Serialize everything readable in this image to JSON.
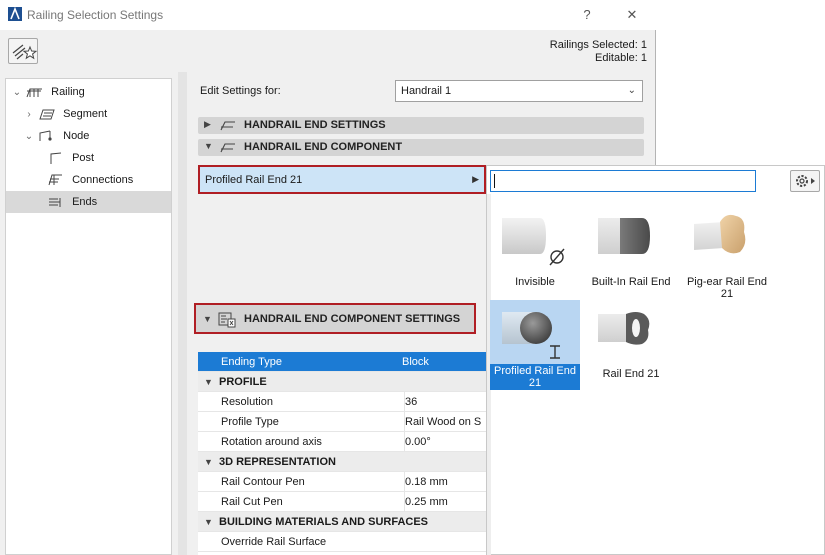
{
  "window": {
    "title": "Railing Selection Settings",
    "help_label": "?",
    "close_label": "✕"
  },
  "info": {
    "selected": "Railings Selected: 1",
    "editable": "Editable: 1"
  },
  "tree": {
    "items": [
      {
        "label": "Railing",
        "icon": "railing-icon",
        "expander": "expanded"
      },
      {
        "label": "Segment",
        "icon": "segment-icon",
        "expander": "collapsed"
      },
      {
        "label": "Node",
        "icon": "node-icon",
        "expander": "expanded"
      },
      {
        "label": "Post",
        "icon": "post-icon",
        "expander": "none"
      },
      {
        "label": "Connections",
        "icon": "connections-icon",
        "expander": "none"
      },
      {
        "label": "Ends",
        "icon": "ends-icon",
        "expander": "none",
        "selected": true
      }
    ]
  },
  "edit_settings": {
    "label": "Edit Settings for:",
    "value": "Handrail 1"
  },
  "sections": {
    "end_settings": "HANDRAIL END SETTINGS",
    "end_component": "HANDRAIL END COMPONENT",
    "component_settings": "HANDRAIL END COMPONENT SETTINGS"
  },
  "component": {
    "value": "Profiled Rail End 21"
  },
  "grid": {
    "ending_type": {
      "key": "Ending Type",
      "value": "Block"
    },
    "profile_header": "PROFILE",
    "profile_rows": [
      {
        "key": "Resolution",
        "value": "36"
      },
      {
        "key": "Profile Type",
        "value": "Rail Wood on S"
      },
      {
        "key": "Rotation around axis",
        "value": "0.00°"
      }
    ],
    "rep_header": "3D REPRESENTATION",
    "rep_rows": [
      {
        "key": "Rail Contour Pen",
        "value": "0.18 mm"
      },
      {
        "key": "Rail Cut Pen",
        "value": "0.25 mm"
      }
    ],
    "materials_header": "BUILDING MATERIALS AND SURFACES",
    "materials_rows": [
      {
        "key": "Override Rail Surface",
        "value": ""
      }
    ]
  },
  "popup": {
    "search_value": "",
    "tiles": [
      {
        "label": "Invisible",
        "icon": "invisible-rail-end-icon"
      },
      {
        "label": "Built-In Rail End",
        "icon": "built-in-rail-end-icon"
      },
      {
        "label": "Pig-ear Rail End 21",
        "icon": "pig-ear-rail-end-icon"
      },
      {
        "label": "Profiled Rail End 21",
        "icon": "profiled-rail-end-icon",
        "selected": true
      },
      {
        "label": "Rail End 21",
        "icon": "rail-end-icon"
      }
    ]
  },
  "colors": {
    "accent": "#1c7bd4",
    "highlight_border": "#b01e24",
    "selected_row": "#cde4f7"
  }
}
